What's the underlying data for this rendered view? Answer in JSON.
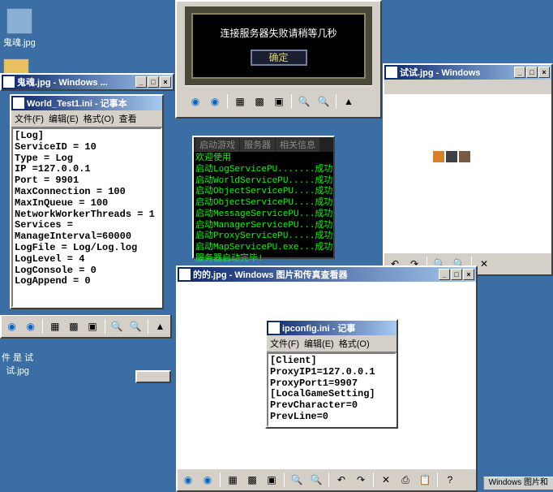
{
  "desktop": {
    "icon1_label": "鬼魂.jpg",
    "icon2_label": "件 是 试",
    "icon3_label": "试.jpg"
  },
  "game_dialog": {
    "message": "连接服务器失败请稍等几秒",
    "ok_label": "确定"
  },
  "notepad1": {
    "title": "World_Test1.ini - 记事本",
    "menu": {
      "file": "文件(F)",
      "edit": "编辑(E)",
      "format": "格式(O)",
      "view": "查看"
    },
    "content": "[Log]\nServiceID = 10\nType = Log\nIP =127.0.0.1\nPort = 9901\nMaxConnection = 100\nMaxInQueue = 100\nNetworkWorkerThreads = 1\nServices =\nManageInterval=60000\nLogFile = Log/Log.log\nLogLevel = 4\nLogConsole = 0\nLogAppend = 0"
  },
  "notepad2": {
    "title": "ipconfig.ini - 记事",
    "menu": {
      "file": "文件(F)",
      "edit": "编辑(E)",
      "format": "格式(O)"
    },
    "content": "[Client]\nProxyIP1=127.0.0.1\nProxyPort1=9907\n[LocalGameSetting]\nPrevCharacter=0\nPrevLine=0"
  },
  "console": {
    "tabs": [
      "启动游戏",
      "服务器",
      "相关信息"
    ],
    "lines": "欢迎使用\n启动LogServicePU.......成功\n启动WorldServicePU.....成功\n启动ObjectServicePU....成功\n启动ObjectServicePU....成功\n启动MessageServicePU...成功\n启动ManagerServicePU...成功\n启动ProxyServicePU.....成功\n启动MapServicePU.exe...成功\n服务器启动完毕!"
  },
  "photoviewer1": {
    "title": "鬼魂.jpg - Windows ..."
  },
  "photoviewer2": {
    "title": "试试.jpg - Windows"
  },
  "photoviewer3": {
    "title": "的的.jpg - Windows 图片和传真查看器"
  },
  "taskbar": {
    "label": "Windows 图片和"
  },
  "colors": {
    "desktop_bg": "#3a6ea5",
    "titlebar_left": "#0a246a",
    "titlebar_right": "#a6caf0",
    "console_fg": "#00ff00"
  }
}
